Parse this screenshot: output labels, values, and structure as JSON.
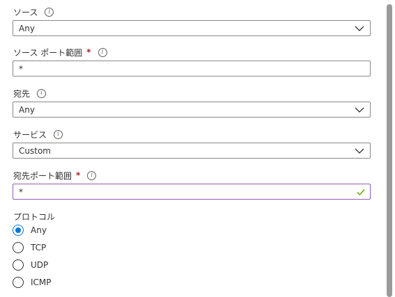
{
  "source": {
    "label": "ソース",
    "value": "Any"
  },
  "source_port": {
    "label": "ソース ポート範囲",
    "required": "*",
    "value": "*"
  },
  "destination": {
    "label": "宛先",
    "value": "Any"
  },
  "service": {
    "label": "サービス",
    "value": "Custom"
  },
  "destination_port": {
    "label": "宛先ポート範囲",
    "required": "*",
    "value": "*"
  },
  "protocol": {
    "label": "プロトコル",
    "options": [
      "Any",
      "TCP",
      "UDP",
      "ICMP"
    ],
    "selected": "Any"
  },
  "icons": {
    "info": "info-icon",
    "chevron": "chevron-down-icon",
    "check": "checkmark-icon"
  },
  "colors": {
    "accent": "#0078d4",
    "required": "#a4262c",
    "focus_border": "#8f5cb8",
    "valid": "#57a300"
  }
}
